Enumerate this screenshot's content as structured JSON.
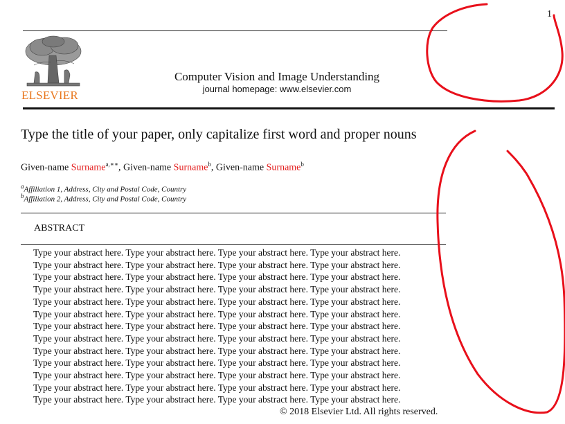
{
  "page": {
    "number": "1"
  },
  "journal": {
    "logo_text": "ELSEVIER",
    "title": "Computer Vision and Image Understanding",
    "homepage": "journal homepage: www.elsevier.com"
  },
  "paper": {
    "title": "Type the title of your paper, only capitalize first word and proper nouns",
    "authors": [
      {
        "given": "Given-name",
        "surname": "Surname",
        "marks": "a,∗∗",
        "sep": ", "
      },
      {
        "given": "Given-name",
        "surname": "Surname",
        "marks": "b",
        "sep": ", "
      },
      {
        "given": "Given-name",
        "surname": "Surname",
        "marks": "b",
        "sep": ""
      }
    ],
    "affiliations": [
      {
        "mark": "a",
        "text": "Affiliation 1, Address, City and Postal Code, Country"
      },
      {
        "mark": "b",
        "text": "Affiliation 2, Address, City and Postal Code, Country"
      }
    ],
    "abstract_heading": "ABSTRACT",
    "abstract_lines": [
      "Type your abstract here.  Type your abstract here.  Type your abstract here.  Type your abstract here.",
      "Type your abstract here.  Type your abstract here.  Type your abstract here.  Type your abstract here.",
      "Type your abstract here.  Type your abstract here.  Type your abstract here.  Type your abstract here.",
      "Type your abstract here.  Type your abstract here.  Type your abstract here.  Type your abstract here.",
      "Type your abstract here.  Type your abstract here.  Type your abstract here.  Type your abstract here.",
      "Type your abstract here.  Type your abstract here.  Type your abstract here.  Type your abstract here.",
      "Type your abstract here.  Type your abstract here.  Type your abstract here.  Type your abstract here.",
      "Type your abstract here.  Type your abstract here.  Type your abstract here.  Type your abstract here.",
      "Type your abstract here.  Type your abstract here.  Type your abstract here.  Type your abstract here.",
      "Type your abstract here.  Type your abstract here.  Type your abstract here.  Type your abstract here.",
      "Type your abstract here.  Type your abstract here.  Type your abstract here.  Type your abstract here.",
      "Type your abstract here.  Type your abstract here.  Type your abstract here.  Type your abstract here.",
      "Type your abstract here. Type your abstract here. Type your abstract here. Type your abstract here."
    ],
    "copyright": "© 2018 Elsevier Ltd. All rights reserved."
  },
  "colors": {
    "surname": "#e31b1b",
    "logo": "#e8761c",
    "annotation": "#e8101b"
  }
}
